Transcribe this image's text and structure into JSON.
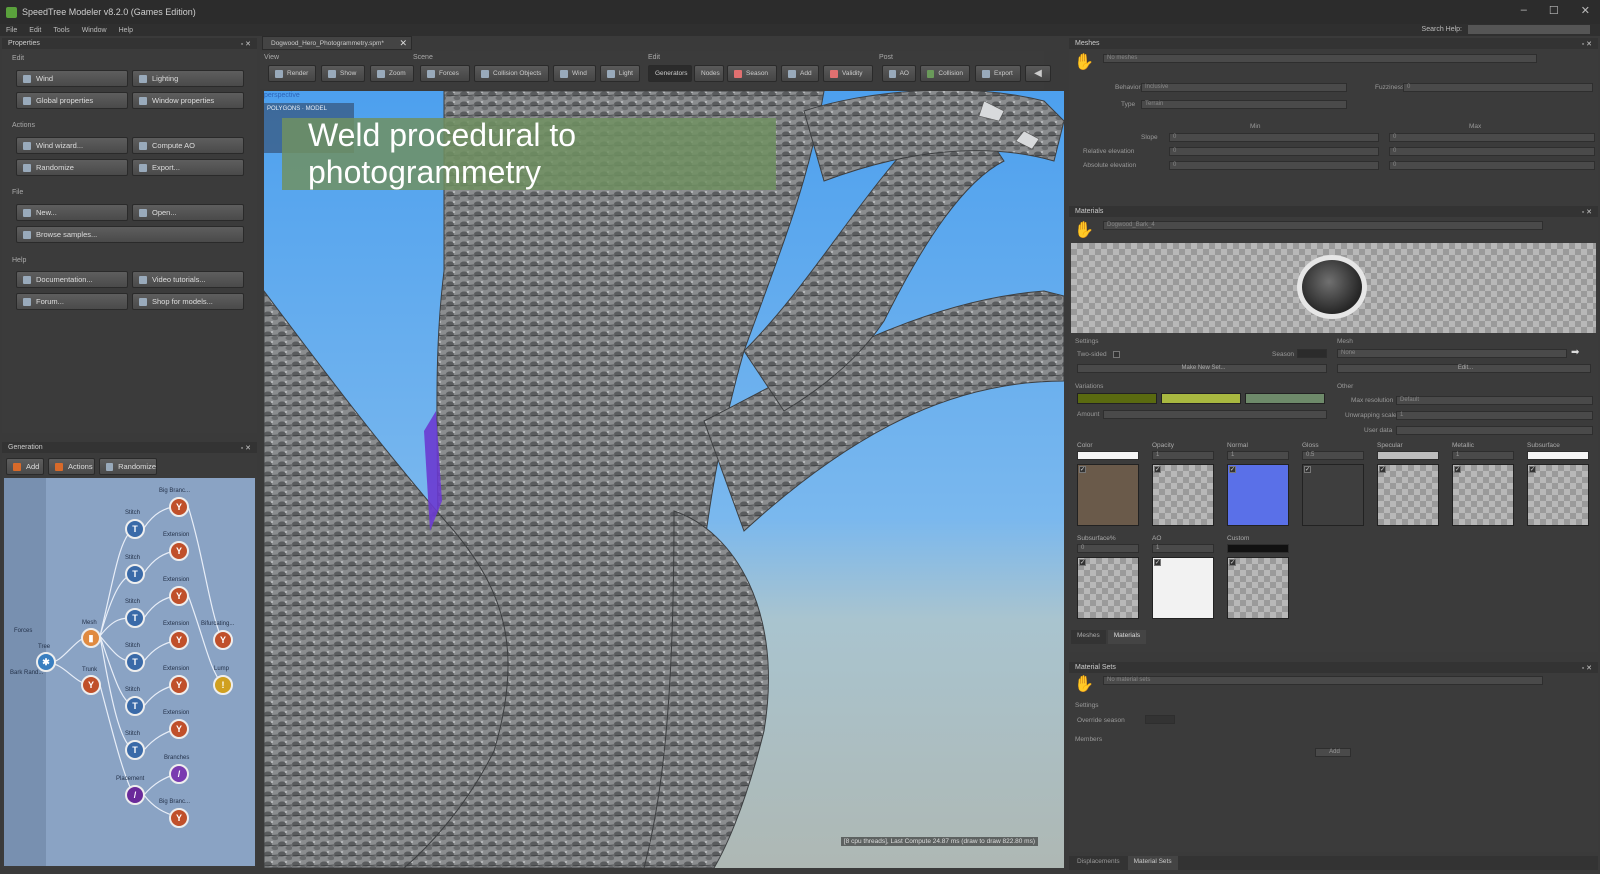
{
  "app": {
    "title": "SpeedTree Modeler v8.2.0 (Games Edition)",
    "min": "–",
    "max": "☐",
    "close": "✕"
  },
  "menu": [
    "File",
    "Edit",
    "Tools",
    "Window",
    "Help"
  ],
  "search_help": {
    "label": "Search Help:",
    "value": ""
  },
  "properties": {
    "title": "Properties",
    "sections": {
      "edit": "Edit",
      "actions": "Actions",
      "file": "File",
      "help": "Help"
    },
    "edit_buttons": [
      "Wind",
      "Lighting",
      "Global properties",
      "Window properties"
    ],
    "action_buttons": [
      "Wind wizard...",
      "Compute AO",
      "Randomize",
      "Export..."
    ],
    "file_buttons": [
      "New...",
      "Open...",
      "Browse samples..."
    ],
    "help_buttons": [
      "Documentation...",
      "Video tutorials...",
      "Forum...",
      "Shop for models..."
    ]
  },
  "generation": {
    "title": "Generation",
    "buttons": [
      "Add",
      "Actions",
      "Randomize"
    ],
    "nodes": {
      "tree": "Tree",
      "mesh": "Mesh",
      "trunk": "Trunk",
      "stitch": [
        "Stitch",
        "Stitch",
        "Stitch",
        "Stitch",
        "Stitch",
        "Stitch"
      ],
      "col3": [
        "Big Branc...",
        "Extension",
        "Extension",
        "Extension",
        "Extension",
        "Extension",
        "Branches",
        "Big Branc..."
      ],
      "bifurcating": "Bifurcating...",
      "lump": "Lump",
      "placement": "Placement",
      "side_labels": [
        "Forces",
        "Bark Rand..."
      ]
    }
  },
  "document_tab": "Dogwood_Hero_Photogrammetry.spm*",
  "toolbar": {
    "groups": [
      "View",
      "Scene",
      "Edit",
      "Post"
    ],
    "view": [
      "Render",
      "Show",
      "Zoom"
    ],
    "scene": [
      "Forces",
      "Collision Objects",
      "Wind",
      "Light"
    ],
    "edit": [
      "Generators",
      "Nodes",
      "Season",
      "Add",
      "Validity"
    ],
    "post": [
      "AO",
      "Collision",
      "Export"
    ]
  },
  "viewport": {
    "camera": "perspective",
    "mode": "POLYGONS · MODEL",
    "banner": "Weld procedural to photogrammetry",
    "status": "[8 cpu threads], Last Compute 24.87 ms (draw to draw 822.80 ms)"
  },
  "meshes": {
    "title": "Meshes",
    "current": "No meshes",
    "behavior_label": "Behavior",
    "behavior_value": "Inclusive",
    "type_label": "Type",
    "type_value": "Terrain",
    "fuzziness_label": "Fuzziness",
    "fuzziness_value": "0",
    "min_label": "Min",
    "max_label": "Max",
    "rows": [
      {
        "label": "Slope",
        "min": "0",
        "max": "0"
      },
      {
        "label": "Relative elevation",
        "min": "0",
        "max": "0"
      },
      {
        "label": "Absolute elevation",
        "min": "0",
        "max": "0"
      }
    ]
  },
  "materials": {
    "title": "Materials",
    "current": "Dogwood_Bark_4",
    "settings_label": "Settings",
    "two_sided_label": "Two-sided",
    "season_label": "Season",
    "make_new_set": "Make New Set...",
    "mesh_label": "Mesh",
    "mesh_value": "None",
    "edit_button": "Edit...",
    "variations_label": "Variations",
    "amount_label": "Amount",
    "variation_colors": [
      "#5a6a10",
      "#a8b840",
      "#6e8a6a"
    ],
    "other_label": "Other",
    "max_resolution_label": "Max resolution",
    "max_resolution_value": "Default",
    "unwrapping_label": "Unwrapping scale",
    "unwrapping_value": "1",
    "user_data_label": "User data",
    "user_data_value": "",
    "slots": [
      {
        "name": "Color",
        "value": ""
      },
      {
        "name": "Opacity",
        "value": "1"
      },
      {
        "name": "Normal",
        "value": "1"
      },
      {
        "name": "Gloss",
        "value": "0.5"
      },
      {
        "name": "Specular",
        "value": ""
      },
      {
        "name": "Metallic",
        "value": "1"
      },
      {
        "name": "Subsurface",
        "value": ""
      },
      {
        "name": "Subsurface%",
        "value": "0"
      },
      {
        "name": "AO",
        "value": "1"
      },
      {
        "name": "Custom",
        "value": ""
      }
    ],
    "tabs": [
      "Meshes",
      "Materials"
    ]
  },
  "material_sets": {
    "title": "Material Sets",
    "current": "No material sets",
    "settings_label": "Settings",
    "override_label": "Override season",
    "members_label": "Members",
    "add_button": "Add"
  },
  "bottom_tabs": [
    "Displacements",
    "Material Sets"
  ]
}
